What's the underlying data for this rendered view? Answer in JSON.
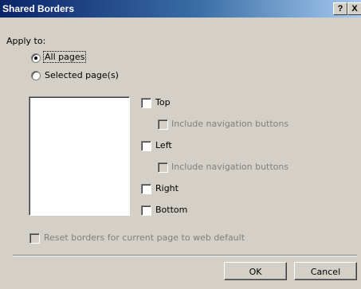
{
  "window": {
    "title": "Shared Borders",
    "help_label": "?",
    "close_label": "X"
  },
  "apply_to": {
    "label": "Apply to:",
    "options": [
      {
        "label": "All pages",
        "selected": true
      },
      {
        "label": "Selected page(s)",
        "selected": false
      }
    ]
  },
  "borders": {
    "top": {
      "label": "Top",
      "checked": false
    },
    "top_nav": {
      "label": "Include navigation buttons",
      "checked": false,
      "enabled": false
    },
    "left": {
      "label": "Left",
      "checked": false
    },
    "left_nav": {
      "label": "Include navigation buttons",
      "checked": false,
      "enabled": false
    },
    "right": {
      "label": "Right",
      "checked": false
    },
    "bottom": {
      "label": "Bottom",
      "checked": false
    }
  },
  "reset": {
    "label": "Reset borders for current page to web default",
    "checked": false,
    "enabled": false
  },
  "buttons": {
    "ok": "OK",
    "cancel": "Cancel"
  }
}
